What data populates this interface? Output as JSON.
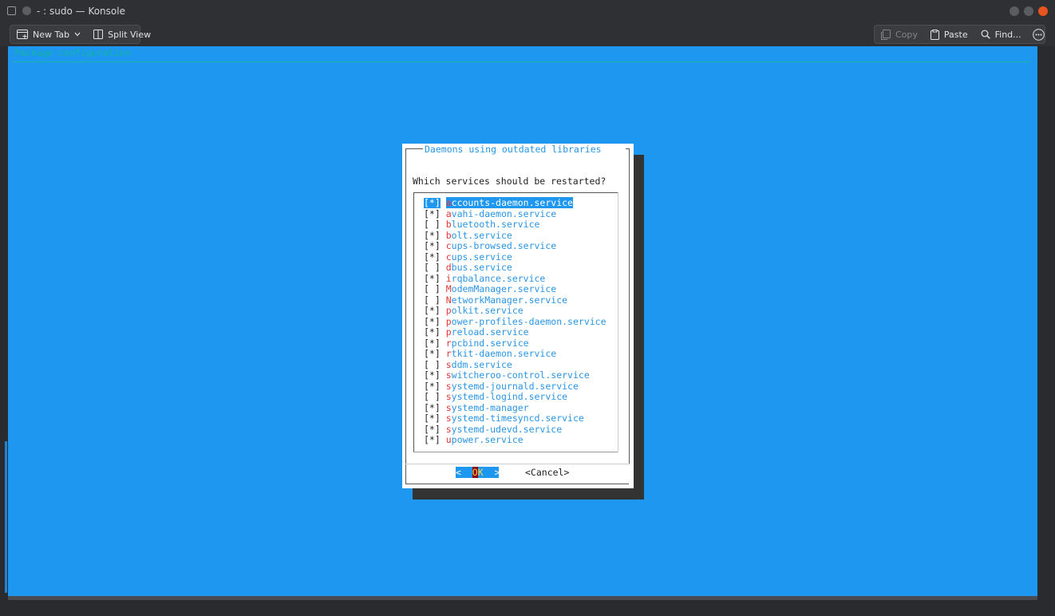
{
  "window": {
    "title": "- : sudo — Konsole",
    "icon": "terminal-icon"
  },
  "toolbar": {
    "new_tab": "New Tab",
    "split_view": "Split View",
    "copy": "Copy",
    "paste": "Paste",
    "find": "Find..."
  },
  "terminal": {
    "header": "Package configuration"
  },
  "dialog": {
    "title": "Daemons using outdated libraries",
    "prompt": "Which services should be restarted?",
    "items": [
      {
        "check": "[*]",
        "hot": "a",
        "rest": "ccounts-daemon.service",
        "selected": true
      },
      {
        "check": "[*]",
        "hot": "a",
        "rest": "vahi-daemon.service"
      },
      {
        "check": "[ ]",
        "hot": "b",
        "rest": "luetooth.service"
      },
      {
        "check": "[*]",
        "hot": "b",
        "rest": "olt.service"
      },
      {
        "check": "[*]",
        "hot": "c",
        "rest": "ups-browsed.service"
      },
      {
        "check": "[*]",
        "hot": "c",
        "rest": "ups.service"
      },
      {
        "check": "[ ]",
        "hot": "d",
        "rest": "bus.service"
      },
      {
        "check": "[*]",
        "hot": "i",
        "rest": "rqbalance.service"
      },
      {
        "check": "[ ]",
        "hot": "M",
        "rest": "odemManager.service"
      },
      {
        "check": "[ ]",
        "hot": "N",
        "rest": "etworkManager.service"
      },
      {
        "check": "[*]",
        "hot": "p",
        "rest": "olkit.service"
      },
      {
        "check": "[*]",
        "hot": "p",
        "rest": "ower-profiles-daemon.service"
      },
      {
        "check": "[*]",
        "hot": "p",
        "rest": "reload.service"
      },
      {
        "check": "[*]",
        "hot": "r",
        "rest": "pcbind.service"
      },
      {
        "check": "[*]",
        "hot": "r",
        "rest": "tkit-daemon.service"
      },
      {
        "check": "[ ]",
        "hot": "s",
        "rest": "ddm.service"
      },
      {
        "check": "[*]",
        "hot": "s",
        "rest": "witcheroo-control.service"
      },
      {
        "check": "[*]",
        "hot": "s",
        "rest": "ystemd-journald.service"
      },
      {
        "check": "[ ]",
        "hot": "s",
        "rest": "ystemd-logind.service"
      },
      {
        "check": "[*]",
        "hot": "s",
        "rest": "ystemd-manager"
      },
      {
        "check": "[*]",
        "hot": "s",
        "rest": "ystemd-timesyncd.service"
      },
      {
        "check": "[*]",
        "hot": "s",
        "rest": "ystemd-udevd.service"
      },
      {
        "check": "[*]",
        "hot": "u",
        "rest": "power.service"
      }
    ],
    "ok_left": "<",
    "ok_hot": "O",
    "ok_rest": "K",
    "ok_right": ">",
    "cancel": "<Cancel>"
  },
  "colors": {
    "terminal_bg": "#1e97f0",
    "accent_text": "#2a95e5",
    "hotkey": "#e53935",
    "close_button": "#e8541d"
  }
}
